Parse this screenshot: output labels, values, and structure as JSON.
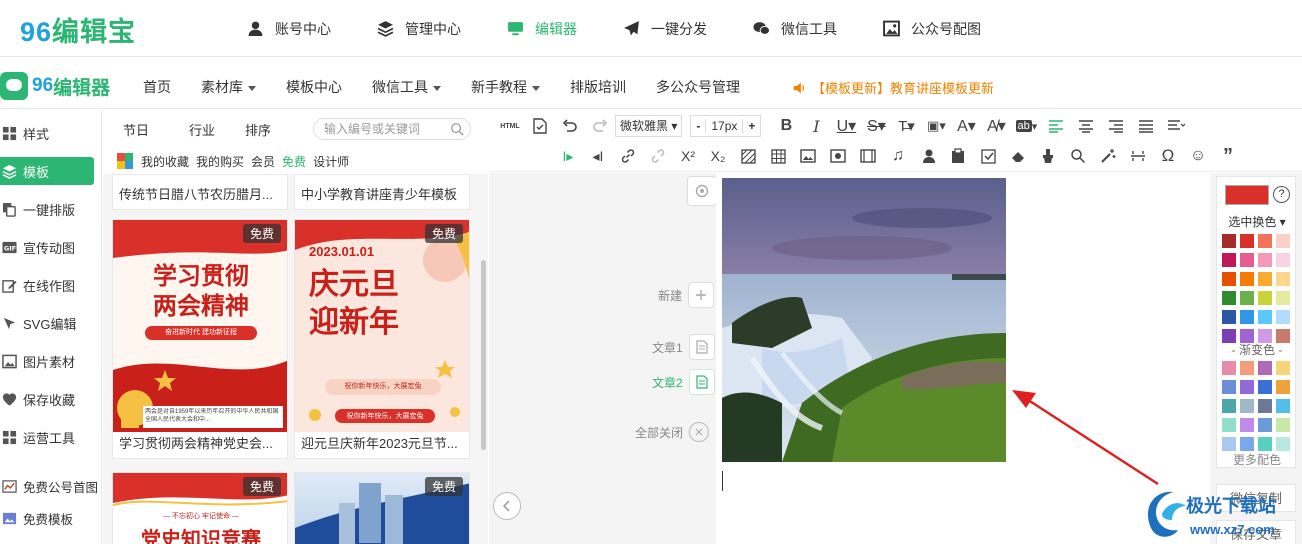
{
  "topbar": {
    "logo_num": "96",
    "logo_text": "编辑宝",
    "nav": [
      {
        "label": "账号中心",
        "icon": "user-icon"
      },
      {
        "label": "管理中心",
        "icon": "layers-icon"
      },
      {
        "label": "编辑器",
        "icon": "monitor-icon",
        "active": true
      },
      {
        "label": "一键分发",
        "icon": "paper-plane-icon"
      },
      {
        "label": "微信工具",
        "icon": "wechat-icon"
      },
      {
        "label": "公众号配图",
        "icon": "image-icon"
      }
    ]
  },
  "nav2": {
    "logo_num": "96",
    "logo_text": "编辑器",
    "menu": [
      {
        "label": "首页",
        "caret": false
      },
      {
        "label": "素材库",
        "caret": true
      },
      {
        "label": "模板中心",
        "caret": false
      },
      {
        "label": "微信工具",
        "caret": true
      },
      {
        "label": "新手教程",
        "caret": true
      },
      {
        "label": "排版培训",
        "caret": false
      },
      {
        "label": "多公众号管理",
        "caret": false
      }
    ],
    "notice": "【模板更新】教育讲座模板更新"
  },
  "sidebar": {
    "items": [
      {
        "label": "样式",
        "icon": "grid-icon"
      },
      {
        "label": "模板",
        "icon": "layers-icon",
        "active": true
      },
      {
        "label": "一键排版",
        "icon": "copy-icon"
      },
      {
        "label": "宣传动图",
        "icon": "gif-icon"
      },
      {
        "label": "在线作图",
        "icon": "pencil-icon"
      },
      {
        "label": "SVG编辑",
        "icon": "cursor-icon"
      },
      {
        "label": "图片素材",
        "icon": "picture-icon"
      },
      {
        "label": "保存收藏",
        "icon": "heart-icon"
      },
      {
        "label": "运营工具",
        "icon": "apps-icon"
      },
      {
        "label": "免费公号首图",
        "icon": "chart-icon"
      },
      {
        "label": "免费模板",
        "icon": "image-icon"
      }
    ]
  },
  "templates": {
    "tabs": [
      "节日",
      "行业",
      "排序"
    ],
    "search_placeholder": "输入编号或关键词",
    "filters": [
      {
        "label": "我的收藏",
        "green": false
      },
      {
        "label": "我的购买",
        "green": false
      },
      {
        "label": "会员",
        "green": false
      },
      {
        "label": "免费",
        "green": true
      },
      {
        "label": "设计师",
        "green": false
      }
    ],
    "cards": [
      {
        "title": "传统节日腊八节农历腊月..."
      },
      {
        "title": "中小学教育讲座青少年模板"
      },
      {
        "title": "学习贯彻两会精神党史会...",
        "badge": "免费",
        "thumb_lines": [
          "学习贯彻",
          "两会精神"
        ],
        "thumb_ribbon": "奋进新时代 建功新征程",
        "thumb_body": "两会是对自1959年以来历年召开的中华人民共和国全国人民代表大会和中..."
      },
      {
        "title": "迎元旦庆新年2023元旦节...",
        "badge": "免费",
        "thumb_date": "2023.01.01",
        "thumb_lines": [
          "庆元旦",
          "迎新年"
        ],
        "thumb_ribbon": "祝你新年快乐，大展宏兔",
        "thumb_ribbon2": "祝你新年快乐，大展宏兔"
      },
      {
        "title": "",
        "badge": "免费",
        "thumb_small": "— 不忘初心 牢记使命 —",
        "thumb_lines": [
          "党史知识竞赛"
        ]
      },
      {
        "title": "",
        "badge": "免费"
      }
    ]
  },
  "toolbar": {
    "html_label": "HTML",
    "font": "微软雅黑",
    "size_minus": "-",
    "size": "17px",
    "size_plus": "+"
  },
  "sideops": {
    "new": "新建",
    "article1": "文章1",
    "article2": "文章2",
    "close_all": "全部关闭"
  },
  "colorpanel": {
    "selected_color": "#d9302a",
    "help": "?",
    "label_select": "选中换色",
    "label_gradient": "- 渐变色 -",
    "more": "更多配色",
    "solid": [
      "#a52a2a",
      "#d9302a",
      "#f0735a",
      "#fbd0c8",
      "#c2185b",
      "#e85d8f",
      "#f49ab8",
      "#fbd3e0",
      "#e65100",
      "#f57c00",
      "#fbaa30",
      "#fcd68c",
      "#2e8b2e",
      "#6ab04c",
      "#c8d43a",
      "#e6ea9c",
      "#2b57a4",
      "#3096e8",
      "#5ac8fa",
      "#b3dcfa",
      "#7b3fb5",
      "#a163d6",
      "#cf9be6",
      "#c87a6c"
    ],
    "gradient": [
      "#e88aa8",
      "#f49c7c",
      "#b06ab3",
      "#f7d67a",
      "#6a8fd8",
      "#8f6ad8",
      "#3a6fd8",
      "#f0a23a",
      "#4aa8a8",
      "#a0b8c8",
      "#6a7a98",
      "#50c0e8",
      "#8fe0c8",
      "#c08ae8",
      "#6a9ad8",
      "#c8e8a8",
      "#a8c8f0",
      "#7aa8e8",
      "#58d0c0",
      "#b8e8e0"
    ]
  },
  "right_buttons": {
    "wechat_copy": "微信复制",
    "save_article": "保存文章"
  },
  "watermark": {
    "text": "极光下载站",
    "sub": "www.xz7.com"
  }
}
